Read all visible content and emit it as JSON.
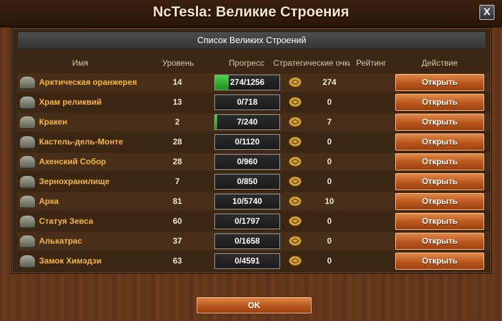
{
  "window": {
    "title": "NcTesla: Великие Строения",
    "close_label": "X"
  },
  "panel": {
    "title": "Список Великих Строений"
  },
  "columns": {
    "name": "Имя",
    "level": "Уровень",
    "progress": "Прогресс",
    "strategic_points": "Стратегические очки",
    "rating": "Рейтинг",
    "action": "Действие"
  },
  "rows": [
    {
      "name": "Арктическая оранжерея",
      "level": "14",
      "progress": "274/1256",
      "progress_fraction": 0.218,
      "points": "274",
      "action": "Открыть"
    },
    {
      "name": "Храм реликвий",
      "level": "13",
      "progress": "0/718",
      "progress_fraction": 0,
      "points": "0",
      "action": "Открыть"
    },
    {
      "name": "Кракен",
      "level": "2",
      "progress": "7/240",
      "progress_fraction": 0.029,
      "points": "7",
      "action": "Открыть"
    },
    {
      "name": "Кастель-дель-Монте",
      "level": "28",
      "progress": "0/1120",
      "progress_fraction": 0,
      "points": "0",
      "action": "Открыть"
    },
    {
      "name": "Ахенский Собор",
      "level": "28",
      "progress": "0/960",
      "progress_fraction": 0,
      "points": "0",
      "action": "Открыть"
    },
    {
      "name": "Зернохранилище",
      "level": "7",
      "progress": "0/850",
      "progress_fraction": 0,
      "points": "0",
      "action": "Открыть"
    },
    {
      "name": "Арка",
      "level": "81",
      "progress": "10/5740",
      "progress_fraction": 0.002,
      "points": "10",
      "action": "Открыть"
    },
    {
      "name": "Статуя Зевса",
      "level": "60",
      "progress": "0/1797",
      "progress_fraction": 0,
      "points": "0",
      "action": "Открыть"
    },
    {
      "name": "Алькатрас",
      "level": "37",
      "progress": "0/1658",
      "progress_fraction": 0,
      "points": "0",
      "action": "Открыть"
    },
    {
      "name": "Замок Химэдзи",
      "level": "63",
      "progress": "0/4591",
      "progress_fraction": 0,
      "points": "0",
      "action": "Открыть"
    }
  ],
  "icons": {
    "building": "great-building-icon",
    "forge_points": "forge-points-icon",
    "close": "close-icon"
  },
  "colors": {
    "name_text": "#f5b63a",
    "button": "#b9551c",
    "progress_fill": "#3fb23c"
  },
  "footer": {
    "ok_label": "OK"
  }
}
